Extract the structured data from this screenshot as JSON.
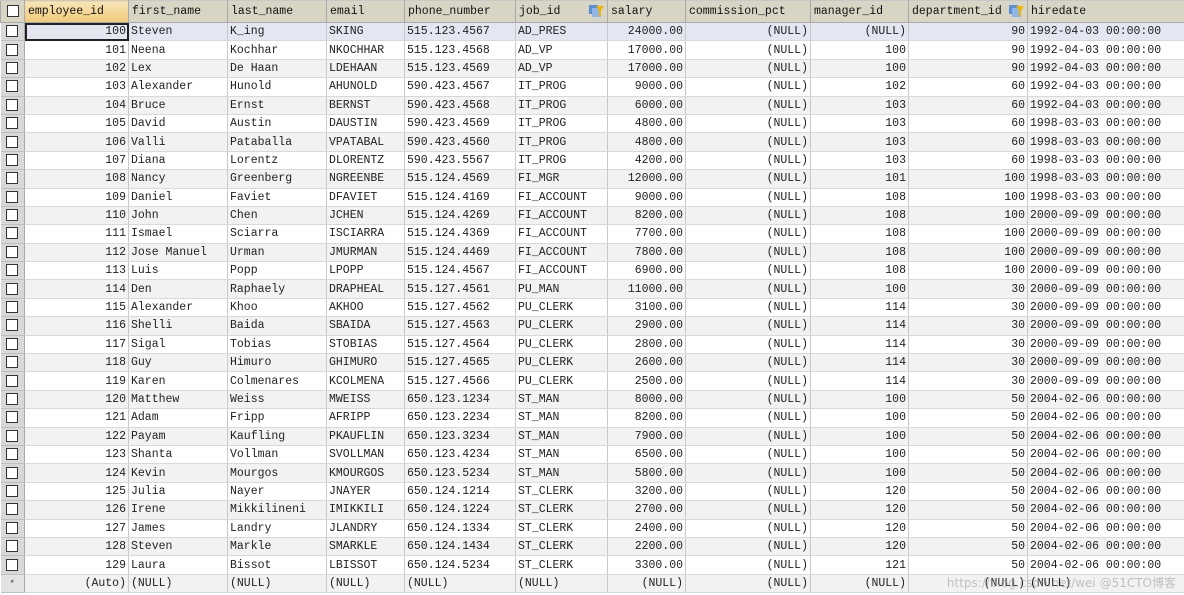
{
  "grid": {
    "columns": [
      {
        "key": "employee_id",
        "label": "employee_id",
        "align": "right",
        "sorted": true,
        "filter_icon": false
      },
      {
        "key": "first_name",
        "label": "first_name",
        "align": "left",
        "sorted": false,
        "filter_icon": false
      },
      {
        "key": "last_name",
        "label": "last_name",
        "align": "left",
        "sorted": false,
        "filter_icon": false
      },
      {
        "key": "email",
        "label": "email",
        "align": "left",
        "sorted": false,
        "filter_icon": false
      },
      {
        "key": "phone_number",
        "label": "phone_number",
        "align": "left",
        "sorted": false,
        "filter_icon": false
      },
      {
        "key": "job_id",
        "label": "job_id",
        "align": "left",
        "sorted": false,
        "filter_icon": true
      },
      {
        "key": "salary",
        "label": "salary",
        "align": "right",
        "sorted": false,
        "filter_icon": false
      },
      {
        "key": "commission_pct",
        "label": "commission_pct",
        "align": "right",
        "sorted": false,
        "filter_icon": false
      },
      {
        "key": "manager_id",
        "label": "manager_id",
        "align": "right",
        "sorted": false,
        "filter_icon": false
      },
      {
        "key": "department_id",
        "label": "department_id",
        "align": "right",
        "sorted": false,
        "filter_icon": true
      },
      {
        "key": "hiredate",
        "label": "hiredate",
        "align": "left",
        "sorted": false,
        "filter_icon": false
      }
    ],
    "rows": [
      [
        "100",
        "Steven",
        "K_ing",
        "SKING",
        "515.123.4567",
        "AD_PRES",
        "24000.00",
        "(NULL)",
        "(NULL)",
        "90",
        "1992-04-03 00:00:00"
      ],
      [
        "101",
        "Neena",
        "Kochhar",
        "NKOCHHAR",
        "515.123.4568",
        "AD_VP",
        "17000.00",
        "(NULL)",
        "100",
        "90",
        "1992-04-03 00:00:00"
      ],
      [
        "102",
        "Lex",
        "De Haan",
        "LDEHAAN",
        "515.123.4569",
        "AD_VP",
        "17000.00",
        "(NULL)",
        "100",
        "90",
        "1992-04-03 00:00:00"
      ],
      [
        "103",
        "Alexander",
        "Hunold",
        "AHUNOLD",
        "590.423.4567",
        "IT_PROG",
        "9000.00",
        "(NULL)",
        "102",
        "60",
        "1992-04-03 00:00:00"
      ],
      [
        "104",
        "Bruce",
        "Ernst",
        "BERNST",
        "590.423.4568",
        "IT_PROG",
        "6000.00",
        "(NULL)",
        "103",
        "60",
        "1992-04-03 00:00:00"
      ],
      [
        "105",
        "David",
        "Austin",
        "DAUSTIN",
        "590.423.4569",
        "IT_PROG",
        "4800.00",
        "(NULL)",
        "103",
        "60",
        "1998-03-03 00:00:00"
      ],
      [
        "106",
        "Valli",
        "Pataballa",
        "VPATABAL",
        "590.423.4560",
        "IT_PROG",
        "4800.00",
        "(NULL)",
        "103",
        "60",
        "1998-03-03 00:00:00"
      ],
      [
        "107",
        "Diana",
        "Lorentz",
        "DLORENTZ",
        "590.423.5567",
        "IT_PROG",
        "4200.00",
        "(NULL)",
        "103",
        "60",
        "1998-03-03 00:00:00"
      ],
      [
        "108",
        "Nancy",
        "Greenberg",
        "NGREENBE",
        "515.124.4569",
        "FI_MGR",
        "12000.00",
        "(NULL)",
        "101",
        "100",
        "1998-03-03 00:00:00"
      ],
      [
        "109",
        "Daniel",
        "Faviet",
        "DFAVIET",
        "515.124.4169",
        "FI_ACCOUNT",
        "9000.00",
        "(NULL)",
        "108",
        "100",
        "1998-03-03 00:00:00"
      ],
      [
        "110",
        "John",
        "Chen",
        "JCHEN",
        "515.124.4269",
        "FI_ACCOUNT",
        "8200.00",
        "(NULL)",
        "108",
        "100",
        "2000-09-09 00:00:00"
      ],
      [
        "111",
        "Ismael",
        "Sciarra",
        "ISCIARRA",
        "515.124.4369",
        "FI_ACCOUNT",
        "7700.00",
        "(NULL)",
        "108",
        "100",
        "2000-09-09 00:00:00"
      ],
      [
        "112",
        "Jose Manuel",
        "Urman",
        "JMURMAN",
        "515.124.4469",
        "FI_ACCOUNT",
        "7800.00",
        "(NULL)",
        "108",
        "100",
        "2000-09-09 00:00:00"
      ],
      [
        "113",
        "Luis",
        "Popp",
        "LPOPP",
        "515.124.4567",
        "FI_ACCOUNT",
        "6900.00",
        "(NULL)",
        "108",
        "100",
        "2000-09-09 00:00:00"
      ],
      [
        "114",
        "Den",
        "Raphaely",
        "DRAPHEAL",
        "515.127.4561",
        "PU_MAN",
        "11000.00",
        "(NULL)",
        "100",
        "30",
        "2000-09-09 00:00:00"
      ],
      [
        "115",
        "Alexander",
        "Khoo",
        "AKHOO",
        "515.127.4562",
        "PU_CLERK",
        "3100.00",
        "(NULL)",
        "114",
        "30",
        "2000-09-09 00:00:00"
      ],
      [
        "116",
        "Shelli",
        "Baida",
        "SBAIDA",
        "515.127.4563",
        "PU_CLERK",
        "2900.00",
        "(NULL)",
        "114",
        "30",
        "2000-09-09 00:00:00"
      ],
      [
        "117",
        "Sigal",
        "Tobias",
        "STOBIAS",
        "515.127.4564",
        "PU_CLERK",
        "2800.00",
        "(NULL)",
        "114",
        "30",
        "2000-09-09 00:00:00"
      ],
      [
        "118",
        "Guy",
        "Himuro",
        "GHIMURO",
        "515.127.4565",
        "PU_CLERK",
        "2600.00",
        "(NULL)",
        "114",
        "30",
        "2000-09-09 00:00:00"
      ],
      [
        "119",
        "Karen",
        "Colmenares",
        "KCOLMENA",
        "515.127.4566",
        "PU_CLERK",
        "2500.00",
        "(NULL)",
        "114",
        "30",
        "2000-09-09 00:00:00"
      ],
      [
        "120",
        "Matthew",
        "Weiss",
        "MWEISS",
        "650.123.1234",
        "ST_MAN",
        "8000.00",
        "(NULL)",
        "100",
        "50",
        "2004-02-06 00:00:00"
      ],
      [
        "121",
        "Adam",
        "Fripp",
        "AFRIPP",
        "650.123.2234",
        "ST_MAN",
        "8200.00",
        "(NULL)",
        "100",
        "50",
        "2004-02-06 00:00:00"
      ],
      [
        "122",
        "Payam",
        "Kaufling",
        "PKAUFLIN",
        "650.123.3234",
        "ST_MAN",
        "7900.00",
        "(NULL)",
        "100",
        "50",
        "2004-02-06 00:00:00"
      ],
      [
        "123",
        "Shanta",
        "Vollman",
        "SVOLLMAN",
        "650.123.4234",
        "ST_MAN",
        "6500.00",
        "(NULL)",
        "100",
        "50",
        "2004-02-06 00:00:00"
      ],
      [
        "124",
        "Kevin",
        "Mourgos",
        "KMOURGOS",
        "650.123.5234",
        "ST_MAN",
        "5800.00",
        "(NULL)",
        "100",
        "50",
        "2004-02-06 00:00:00"
      ],
      [
        "125",
        "Julia",
        "Nayer",
        "JNAYER",
        "650.124.1214",
        "ST_CLERK",
        "3200.00",
        "(NULL)",
        "120",
        "50",
        "2004-02-06 00:00:00"
      ],
      [
        "126",
        "Irene",
        "Mikkilineni",
        "IMIKKILI",
        "650.124.1224",
        "ST_CLERK",
        "2700.00",
        "(NULL)",
        "120",
        "50",
        "2004-02-06 00:00:00"
      ],
      [
        "127",
        "James",
        "Landry",
        "JLANDRY",
        "650.124.1334",
        "ST_CLERK",
        "2400.00",
        "(NULL)",
        "120",
        "50",
        "2004-02-06 00:00:00"
      ],
      [
        "128",
        "Steven",
        "Markle",
        "SMARKLE",
        "650.124.1434",
        "ST_CLERK",
        "2200.00",
        "(NULL)",
        "120",
        "50",
        "2004-02-06 00:00:00"
      ],
      [
        "129",
        "Laura",
        "Bissot",
        "LBISSOT",
        "650.124.5234",
        "ST_CLERK",
        "3300.00",
        "(NULL)",
        "121",
        "50",
        "2004-02-06 00:00:00"
      ]
    ],
    "new_row": {
      "marker": "*",
      "values": [
        "(Auto)",
        "(NULL)",
        "(NULL)",
        "(NULL)",
        "(NULL)",
        "(NULL)",
        "(NULL)",
        "(NULL)",
        "(NULL)",
        "(NULL)",
        "(NULL)"
      ]
    },
    "selected_row_index": 0
  },
  "watermark": "https://blog.csdn.net/wei @51CTO博客",
  "colors": {
    "header_bg": "#d9d5c4",
    "sorted_header_bg": "#efc978",
    "selected_row_bg": "#e4e6f2",
    "odd_row_bg": "#f2f2f2",
    "even_row_bg": "#ffffff",
    "filter_icon_blue": "#5a8fd1",
    "filter_icon_yellow": "#f0b400"
  }
}
